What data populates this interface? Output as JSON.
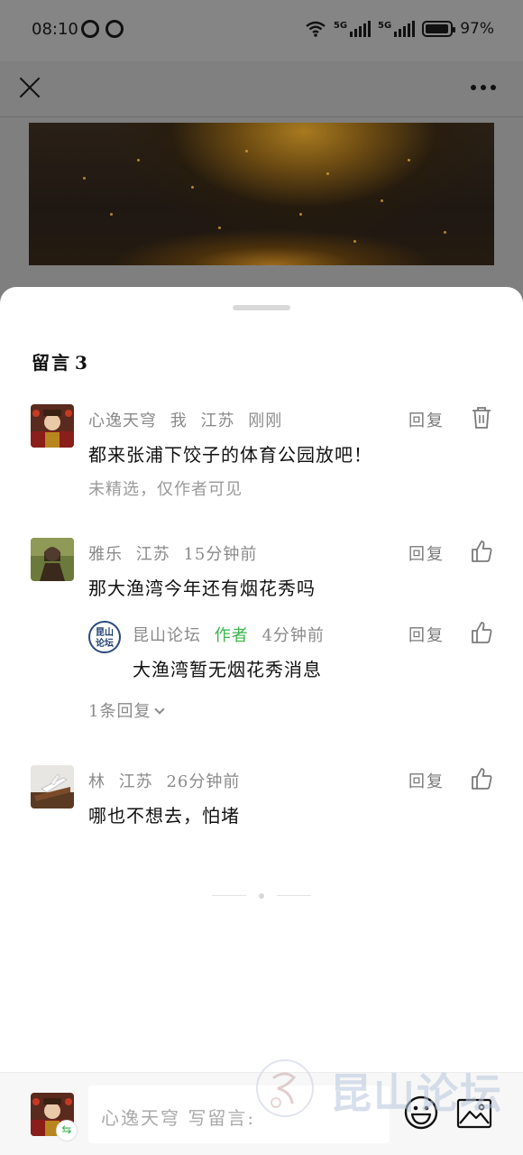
{
  "status_bar": {
    "time": "08:10",
    "network_1": "5G",
    "network_2": "5G",
    "battery": "97%"
  },
  "top_bar": {
    "close_icon": "close-icon",
    "more_icon": "more-horizontal-icon"
  },
  "comments_sheet": {
    "title": "留言",
    "count": "3",
    "reply_label": "回复",
    "comments": [
      {
        "user": "心逸天穹",
        "self_tag": "我",
        "location": "江苏",
        "time": "刚刚",
        "text": "都来张浦下饺子的体育公园放吧！",
        "note": "未精选，仅作者可见",
        "action_icon": "trash-icon"
      },
      {
        "user": "雅乐",
        "location": "江苏",
        "time": "15分钟前",
        "text": "那大渔湾今年还有烟花秀吗",
        "action_icon": "thumbs-up-icon",
        "reply": {
          "user": "昆山论坛",
          "author_tag": "作者",
          "time": "4分钟前",
          "text": "大渔湾暂无烟花秀消息",
          "action_icon": "thumbs-up-icon",
          "avatar_text": "昆山论坛"
        },
        "expand_label": "1条回复"
      },
      {
        "user": "林",
        "location": "江苏",
        "time": "26分钟前",
        "text": "哪也不想去，怕堵",
        "action_icon": "thumbs-up-icon"
      }
    ]
  },
  "input_bar": {
    "placeholder": "心逸天穹 写留言:",
    "emoji_icon": "emoji-icon",
    "image_icon": "image-icon"
  },
  "watermark": {
    "text": "昆山论坛"
  },
  "colors": {
    "author_tag": "#39b54a",
    "meta_text": "#8a8a8a",
    "overlay_bg": "#808080"
  }
}
